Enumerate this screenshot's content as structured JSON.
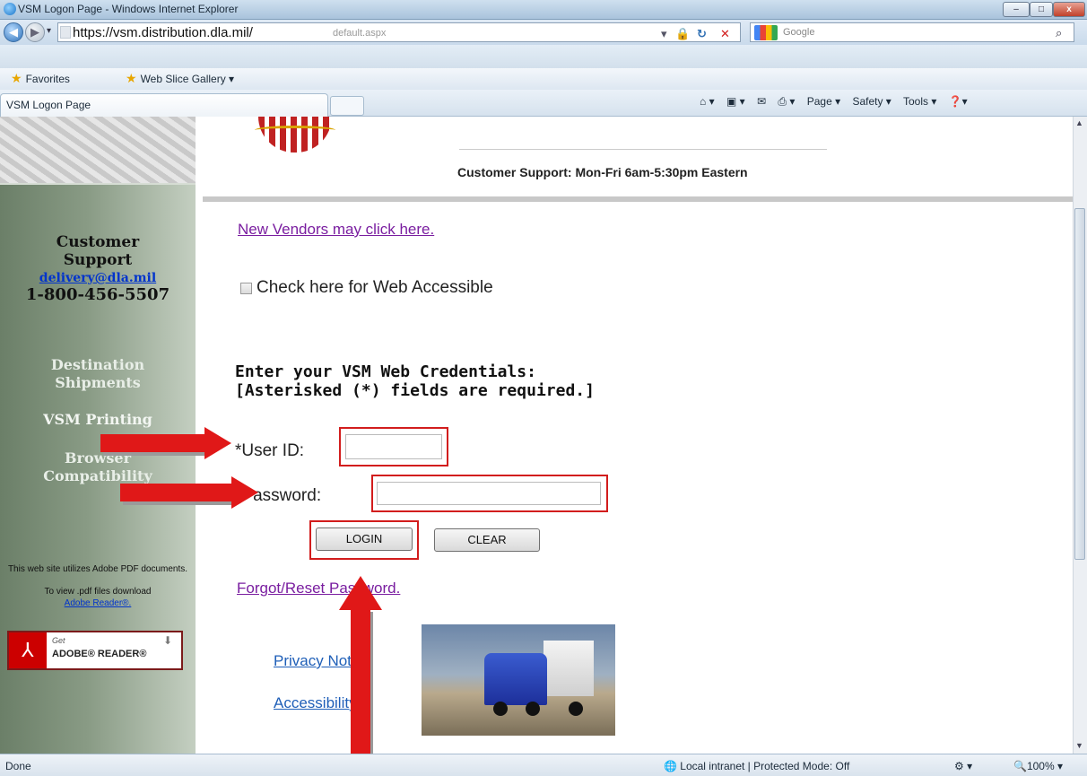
{
  "window": {
    "title": "VSM Logon Page - Windows Internet Explorer",
    "min": "–",
    "max": "□",
    "close": "x"
  },
  "addressbar": {
    "url": "https://vsm.distribution.dla.mil/",
    "url_tail": "default.aspx",
    "search_placeholder": "Google",
    "back_icon": "back-arrow-icon",
    "forward_icon": "forward-arrow-icon"
  },
  "favbar": {
    "favorites": "Favorites",
    "slice_gallery": "Web Slice Gallery ▾"
  },
  "tab": {
    "label": "VSM Logon Page"
  },
  "commandbar": {
    "page": "Page ▾",
    "safety": "Safety ▾",
    "tools": "Tools ▾",
    "help": "❓▾"
  },
  "sidebar": {
    "cs_title_1": "Customer",
    "cs_title_2": "Support",
    "email": "delivery@dla.mil",
    "phone": "1-800-456-5507",
    "links": {
      "dest_1": "Destination",
      "dest_2": "Shipments",
      "printing": "VSM Printing",
      "browser_1": "Browser",
      "browser_2": "Compatibility"
    },
    "adobe_note_1": "This web site utilizes Adobe PDF documents.",
    "adobe_note_2": "To view .pdf files download",
    "adobe_note_link": "Adobe Reader®.",
    "adobe_badge_get": "Get",
    "adobe_badge_name": "ADOBE® READER®"
  },
  "header": {
    "support_hours": "Customer Support: Mon-Fri 6am-5:30pm Eastern"
  },
  "main": {
    "new_vendors": "New Vendors may click here.",
    "web_accessible": "Check here for Web Accessible",
    "cred_title_1": "Enter your VSM Web Credentials:",
    "cred_title_2": "[Asterisked (*) fields are required.]",
    "userid_label": "*User ID:",
    "password_label": "*Password:",
    "login": "LOGIN",
    "clear": "CLEAR",
    "forgot": "Forgot/Reset Password.",
    "privacy": "Privacy Notice",
    "accessibility": "Accessibility"
  },
  "status": {
    "left": "Done",
    "zone": "Local intranet | Protected Mode: Off",
    "zoom": "100%"
  },
  "colors": {
    "accent_red": "#e01818",
    "visited_link": "#7a1ea0",
    "link_blue": "#1f5fb8"
  }
}
